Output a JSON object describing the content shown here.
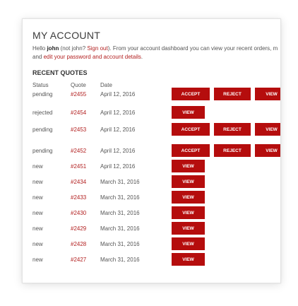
{
  "account": {
    "title": "MY ACCOUNT",
    "intro": {
      "hello": "Hello ",
      "user": "john",
      "not": " (not john? ",
      "sign_out": "Sign out",
      "rest": "). From your account dashboard you can view your recent orders, m",
      "line2_pre": "and ",
      "edit_link": "edit your password and account details",
      "line2_post": "."
    }
  },
  "recent": {
    "heading": "RECENT QUOTES",
    "columns": {
      "status": "Status",
      "quote": "Quote",
      "date": "Date"
    },
    "rows": [
      {
        "status": "pending",
        "quote": "#2455",
        "date": "April 12, 2016",
        "actions": [
          "ACCEPT",
          "REJECT",
          "VIEW"
        ]
      },
      {
        "status": "rejected",
        "quote": "#2454",
        "date": "April 12, 2016",
        "actions": [
          "VIEW"
        ]
      },
      {
        "status": "pending",
        "quote": "#2453",
        "date": "April 12, 2016",
        "actions": [
          "ACCEPT",
          "REJECT",
          "VIEW"
        ]
      },
      {
        "status": "pending",
        "quote": "#2452",
        "date": "April 12, 2016",
        "actions": [
          "ACCEPT",
          "REJECT",
          "VIEW"
        ]
      },
      {
        "status": "new",
        "quote": "#2451",
        "date": "April 12, 2016",
        "actions": [
          "VIEW"
        ]
      },
      {
        "status": "new",
        "quote": "#2434",
        "date": "March 31, 2016",
        "actions": [
          "VIEW"
        ]
      },
      {
        "status": "new",
        "quote": "#2433",
        "date": "March 31, 2016",
        "actions": [
          "VIEW"
        ]
      },
      {
        "status": "new",
        "quote": "#2430",
        "date": "March 31, 2016",
        "actions": [
          "VIEW"
        ]
      },
      {
        "status": "new",
        "quote": "#2429",
        "date": "March 31, 2016",
        "actions": [
          "VIEW"
        ]
      },
      {
        "status": "new",
        "quote": "#2428",
        "date": "March 31, 2016",
        "actions": [
          "VIEW"
        ]
      },
      {
        "status": "new",
        "quote": "#2427",
        "date": "March 31, 2016",
        "actions": [
          "VIEW"
        ]
      }
    ]
  },
  "colors": {
    "accent": "#b50d0d",
    "link": "#b21f1f"
  }
}
